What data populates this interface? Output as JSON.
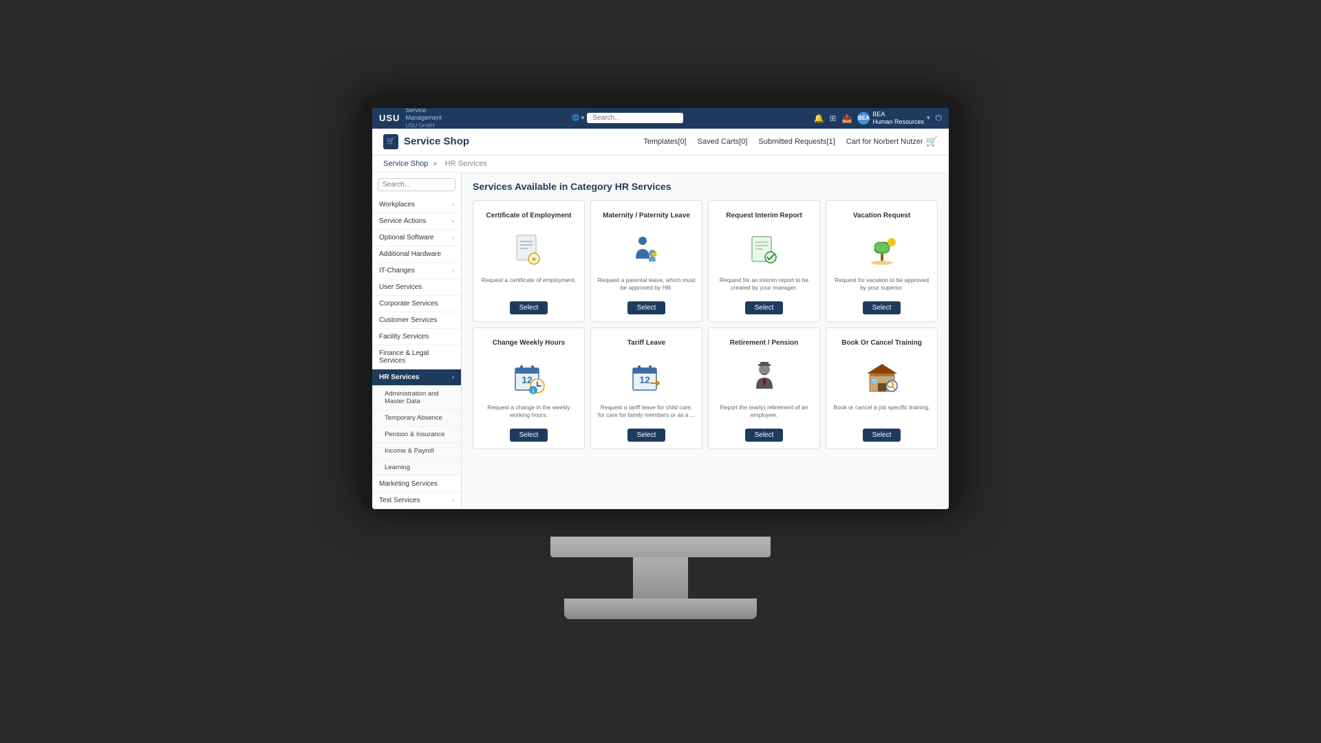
{
  "topbar": {
    "logo": "USU",
    "service_label": "Service\nManagement",
    "search_placeholder": "Search...",
    "user_initials": "BEA",
    "user_label": "BEA\nHuman Resources"
  },
  "app_header": {
    "title": "Service Shop",
    "nav_items": [
      {
        "label": "Templates[0]",
        "key": "templates"
      },
      {
        "label": "Saved Carts[0]",
        "key": "saved_carts"
      },
      {
        "label": "Submitted Requests[1]",
        "key": "submitted"
      },
      {
        "label": "Cart for Norbert Nutzer",
        "key": "cart"
      }
    ]
  },
  "breadcrumb": {
    "root": "Service Shop",
    "separator": "»",
    "current": "HR Services"
  },
  "sidebar": {
    "search_placeholder": "Search...",
    "items": [
      {
        "label": "Workplaces",
        "has_children": true,
        "active": false
      },
      {
        "label": "Service Actions",
        "has_children": true,
        "active": false
      },
      {
        "label": "Optional Software",
        "has_children": true,
        "active": false
      },
      {
        "label": "Additional Hardware",
        "has_children": false,
        "active": false
      },
      {
        "label": "IT-Changes",
        "has_children": true,
        "active": false
      },
      {
        "label": "User Services",
        "has_children": false,
        "active": false
      },
      {
        "label": "Corporate Services",
        "has_children": false,
        "active": false
      },
      {
        "label": "Customer Services",
        "has_children": false,
        "active": false
      },
      {
        "label": "Facility Services",
        "has_children": false,
        "active": false
      },
      {
        "label": "Finance & Legal Services",
        "has_children": false,
        "active": false
      },
      {
        "label": "HR Services",
        "has_children": true,
        "active": true
      },
      {
        "label": "Administration and Master Data",
        "is_sub": true
      },
      {
        "label": "Temporary Absence",
        "is_sub": true
      },
      {
        "label": "Pension & Insurance",
        "is_sub": true
      },
      {
        "label": "Income & Payroll",
        "is_sub": true
      },
      {
        "label": "Learning",
        "is_sub": true
      },
      {
        "label": "Marketing Services",
        "has_children": false,
        "active": false
      },
      {
        "label": "Test Services",
        "has_children": true,
        "active": false
      }
    ]
  },
  "content": {
    "title": "Services Available in Category HR Services",
    "services": [
      {
        "id": "cert-employment",
        "title": "Certificate of Employment",
        "description": "Request a certificate of employment.",
        "icon_type": "document-medal"
      },
      {
        "id": "maternity-leave",
        "title": "Maternity / Paternity Leave",
        "description": "Request a parental leave, which must be approved by HR.",
        "icon_type": "person-baby"
      },
      {
        "id": "interim-report",
        "title": "Request Interim Report",
        "description": "Request for an interim report to be created by your manager.",
        "icon_type": "clipboard-check"
      },
      {
        "id": "vacation-request",
        "title": "Vacation Request",
        "description": "Request for vacation to be approved by your superior.",
        "icon_type": "palm-tree"
      },
      {
        "id": "change-weekly-hours",
        "title": "Change Weekly Hours",
        "description": "Request a change in the weekly working hours.",
        "icon_type": "calendar-clock"
      },
      {
        "id": "tariff-leave",
        "title": "Tariff Leave",
        "description": "Request a tariff leave for child care, for care for family members or as a ...",
        "icon_type": "calendar-arrow"
      },
      {
        "id": "retirement",
        "title": "Retirement / Pension",
        "description": "Report the (early) retirement of an employee.",
        "icon_type": "person-hat"
      },
      {
        "id": "book-training",
        "title": "Book Or Cancel Training",
        "description": "Book or cancel a job specific training.",
        "icon_type": "training-building"
      }
    ],
    "select_label": "Select"
  }
}
